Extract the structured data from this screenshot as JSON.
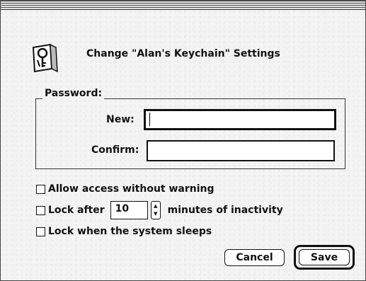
{
  "dialog": {
    "title": "Change \"Alan's Keychain\" Settings",
    "icon": "keychain-icon"
  },
  "password_group": {
    "label": "Password:",
    "new_label": "New:",
    "new_value": "",
    "confirm_label": "Confirm:",
    "confirm_value": ""
  },
  "options": {
    "allow_access_label": "Allow access without warning",
    "allow_access_checked": false,
    "lock_after_prefix": "Lock after",
    "lock_after_minutes": "10",
    "lock_after_suffix": "minutes of inactivity",
    "lock_after_checked": false,
    "lock_on_sleep_label": "Lock when the system sleeps",
    "lock_on_sleep_checked": false
  },
  "buttons": {
    "cancel_label": "Cancel",
    "save_label": "Save",
    "default_button": "save"
  }
}
